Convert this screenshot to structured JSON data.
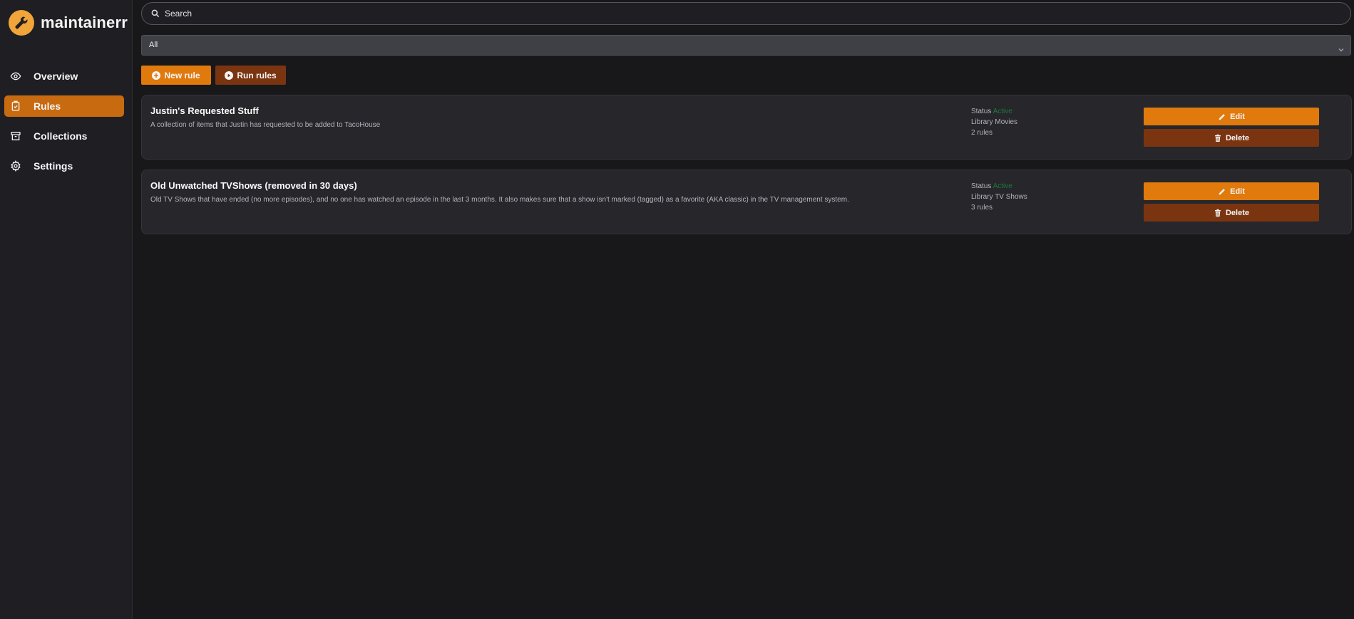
{
  "app": {
    "name": "maintainerr"
  },
  "nav": {
    "items": [
      {
        "label": "Overview",
        "icon": "eye-icon"
      },
      {
        "label": "Rules",
        "icon": "clipboard-check-icon",
        "active": true
      },
      {
        "label": "Collections",
        "icon": "archive-icon"
      },
      {
        "label": "Settings",
        "icon": "gear-icon"
      }
    ]
  },
  "search": {
    "placeholder": "Search",
    "value": ""
  },
  "filter": {
    "selected": "All"
  },
  "toolbar": {
    "new_rule_label": "New rule",
    "run_rules_label": "Run rules"
  },
  "rules": [
    {
      "title": "Justin's Requested Stuff",
      "description": "A collection of items that Justin has requested to be added to TacoHouse",
      "status_label": "Status",
      "status_value": "Active",
      "library_label": "Library",
      "library_value": "Movies",
      "rules_count": "2 rules",
      "edit_label": "Edit",
      "delete_label": "Delete"
    },
    {
      "title": "Old Unwatched TVShows (removed in 30 days)",
      "description": "Old TV Shows that have ended (no more episodes), and no one has watched an episode in the last 3 months. It also makes sure that a show isn't marked (tagged) as a favorite (AKA classic) in the TV management system.",
      "status_label": "Status",
      "status_value": "Active",
      "library_label": "Library",
      "library_value": "TV Shows",
      "rules_count": "3 rules",
      "edit_label": "Edit",
      "delete_label": "Delete"
    }
  ],
  "colors": {
    "accent": "#e07a0d",
    "accent_dark": "#7a3510",
    "active_nav": "#c86a10",
    "status_active": "#1f7a3a",
    "background": "#18181b"
  }
}
